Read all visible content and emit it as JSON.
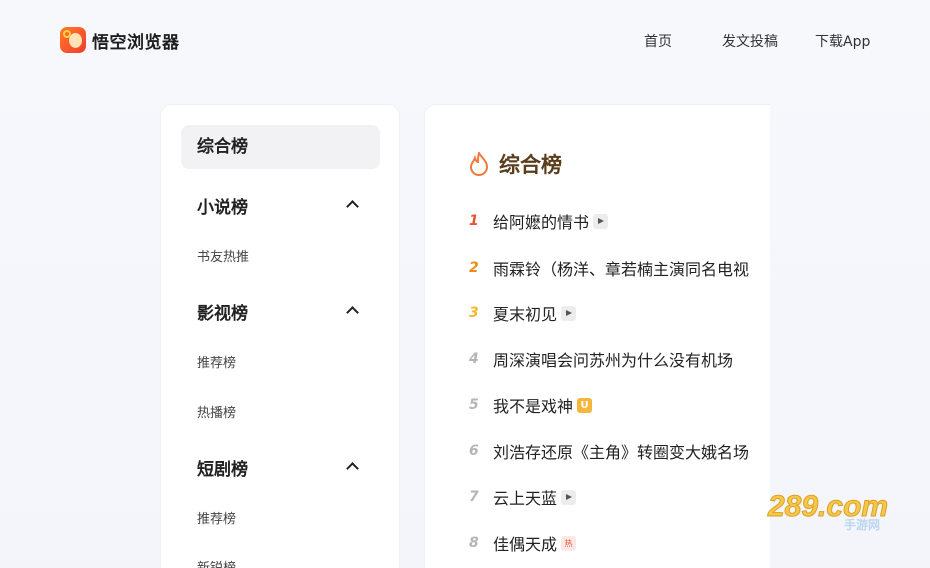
{
  "header": {
    "app_name": "悟空浏览器",
    "nav": [
      "首页",
      "发文投稿",
      "下载App"
    ]
  },
  "sidebar": {
    "top_item": "综合榜",
    "groups": [
      {
        "label": "小说榜",
        "items": [
          "书友热推"
        ]
      },
      {
        "label": "影视榜",
        "items": [
          "推荐榜",
          "热播榜"
        ]
      },
      {
        "label": "短剧榜",
        "items": [
          "推荐榜",
          "新锐榜"
        ]
      }
    ]
  },
  "main": {
    "title": "综合榜",
    "ranks": [
      {
        "num": "1",
        "title": "给阿嬷的情书",
        "badge": "play"
      },
      {
        "num": "2",
        "title": "雨霖铃（杨洋、章若楠主演同名电视",
        "badge": ""
      },
      {
        "num": "3",
        "title": "夏末初见",
        "badge": "play"
      },
      {
        "num": "4",
        "title": "周深演唱会问苏州为什么没有机场",
        "badge": ""
      },
      {
        "num": "5",
        "title": "我不是戏神",
        "badge": "u"
      },
      {
        "num": "6",
        "title": "刘浩存还原《主角》转圈变大娥名场",
        "badge": ""
      },
      {
        "num": "7",
        "title": "云上天蓝",
        "badge": "play"
      },
      {
        "num": "8",
        "title": "佳偶天成",
        "badge": "hot"
      }
    ],
    "badge_u_text": "U",
    "badge_hot_text": "热"
  },
  "watermark": {
    "text": "289.com",
    "sub": "手游网"
  },
  "colors": {
    "rank1": "#e8542e",
    "rank2": "#f08c1a",
    "rank3": "#f3b92a",
    "title_brown": "#5a3e1b",
    "brand": "#f23c2c"
  }
}
